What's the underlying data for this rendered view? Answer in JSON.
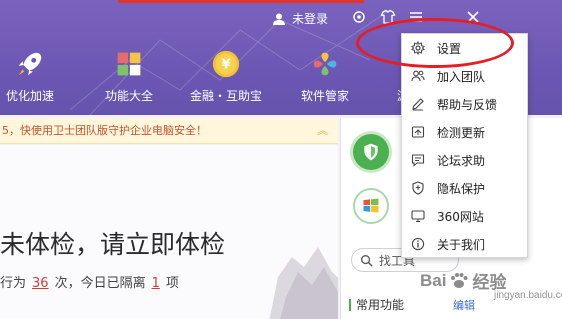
{
  "titlebar": {
    "login_label": "未登录"
  },
  "nav": {
    "items": [
      {
        "label": "优化加速",
        "icon": "rocket-icon"
      },
      {
        "label": "功能大全",
        "icon": "apps-grid-icon"
      },
      {
        "label": "金融・互助宝",
        "icon": "yuan-coin-icon"
      },
      {
        "label": "软件管家",
        "icon": "software-manager-icon"
      },
      {
        "label": "游",
        "icon": "more-icon"
      }
    ]
  },
  "notice": {
    "text": "5，快使用卫士团队版守护企业电脑安全！"
  },
  "main": {
    "headline": "未体检，请立即体检",
    "sub_prefix": "行为",
    "sub_days": "36",
    "sub_middle": "次，今日已隔离",
    "sub_count": "1",
    "sub_suffix": "项"
  },
  "rightpanel": {
    "search_label": "找工具",
    "common_label": "常用功能",
    "edit_label": "编辑"
  },
  "menu": {
    "items": [
      {
        "label": "设置",
        "icon": "gear-icon"
      },
      {
        "label": "加入团队",
        "icon": "team-icon"
      },
      {
        "label": "帮助与反馈",
        "icon": "pencil-icon"
      },
      {
        "label": "检测更新",
        "icon": "update-icon"
      },
      {
        "label": "论坛求助",
        "icon": "forum-icon"
      },
      {
        "label": "隐私保护",
        "icon": "shield-icon"
      },
      {
        "label": "360网站",
        "icon": "monitor-icon"
      },
      {
        "label": "关于我们",
        "icon": "info-icon"
      }
    ]
  },
  "watermark": {
    "brand_left": "Bai",
    "brand_right": "经验",
    "sub": "jingyan.baidu.com"
  },
  "colors": {
    "header_purple": "#6c58b4",
    "annotation_red": "#e51d24",
    "notice_bg": "#fff6dc",
    "highlight_red_number": "#d43d3d"
  }
}
